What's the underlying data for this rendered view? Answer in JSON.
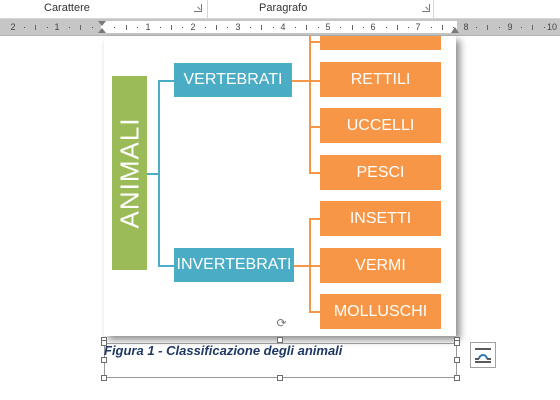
{
  "ribbon": {
    "groups": [
      {
        "label": "Carattere",
        "launcher_icon": "dialog-launcher-icon"
      },
      {
        "label": "Paragrafo",
        "launcher_icon": "dialog-launcher-icon"
      }
    ]
  },
  "ruler": {
    "numbers": [
      "2",
      "1",
      "1",
      "2",
      "3",
      "4",
      "5",
      "6",
      "7",
      "8",
      "9",
      "10"
    ]
  },
  "diagram": {
    "root": "ANIMALI",
    "branches": [
      {
        "label": "VERTEBRATI",
        "children": [
          "RETTILI",
          "UCCELLI",
          "PESCI"
        ]
      },
      {
        "label": "INVERTEBRATI",
        "children": [
          "INSETTI",
          "VERMI",
          "MOLLUSCHI"
        ]
      }
    ],
    "colors": {
      "root": "#9bbb59",
      "branch": "#4bacc6",
      "leaf": "#f79646"
    }
  },
  "caption": "Figura 1 - Classificazione degli animali",
  "layout_options": {
    "icon": "layout-options-icon"
  }
}
